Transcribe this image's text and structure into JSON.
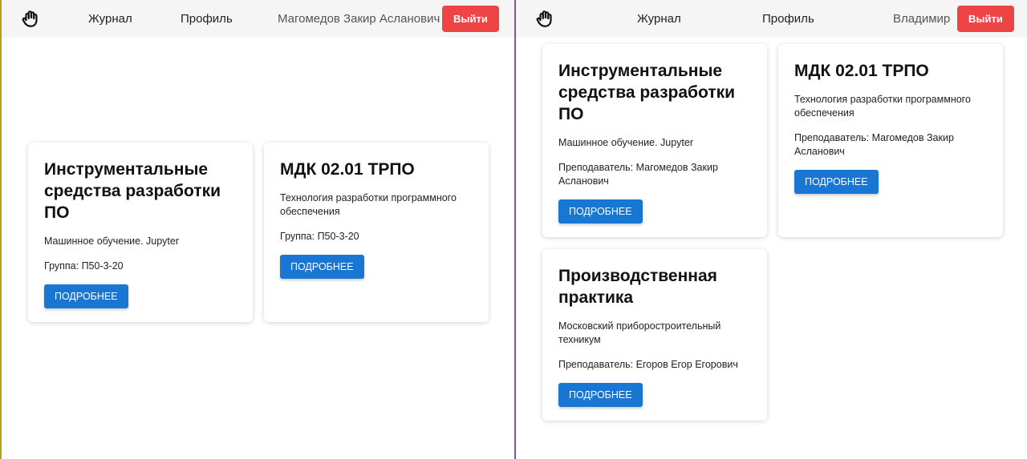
{
  "left": {
    "nav": {
      "journal": "Журнал",
      "profile": "Профиль",
      "user": "Магомедов Закир Асланович",
      "logout": "Выйти"
    },
    "cards": [
      {
        "title": "Инструментальные средства разработки ПО",
        "desc": "Машинное обучение. Jupyter",
        "meta": "Группа: П50-3-20",
        "button": "ПОДРОБНЕЕ"
      },
      {
        "title": "МДК 02.01 ТРПО",
        "desc": "Технология разработки программного обеспечения",
        "meta": "Группа: П50-3-20",
        "button": "ПОДРОБНЕЕ"
      }
    ]
  },
  "right": {
    "nav": {
      "journal": "Журнал",
      "profile": "Профиль",
      "user": "Владимир",
      "logout": "Выйти"
    },
    "cards": [
      {
        "title": "Инструментальные средства разработки ПО",
        "desc": "Машинное обучение. Jupyter",
        "meta": "Преподаватель: Магомедов Закир Асланович",
        "button": "ПОДРОБНЕЕ"
      },
      {
        "title": "МДК 02.01 ТРПО",
        "desc": "Технология разработки программного обеспечения",
        "meta": "Преподаватель: Магомедов Закир Асланович",
        "button": "ПОДРОБНЕЕ"
      },
      {
        "title": "Производственная практика",
        "desc": "Московский приборостроительный техникум",
        "meta": "Преподаватель: Егоров Егор Егорович",
        "button": "ПОДРОБНЕЕ"
      }
    ]
  },
  "icons": {
    "logo": "hand-icon"
  },
  "colors": {
    "logout_bg": "#ef4444",
    "primary_btn": "#1976d2",
    "navbar_bg": "#f5f5f5"
  }
}
